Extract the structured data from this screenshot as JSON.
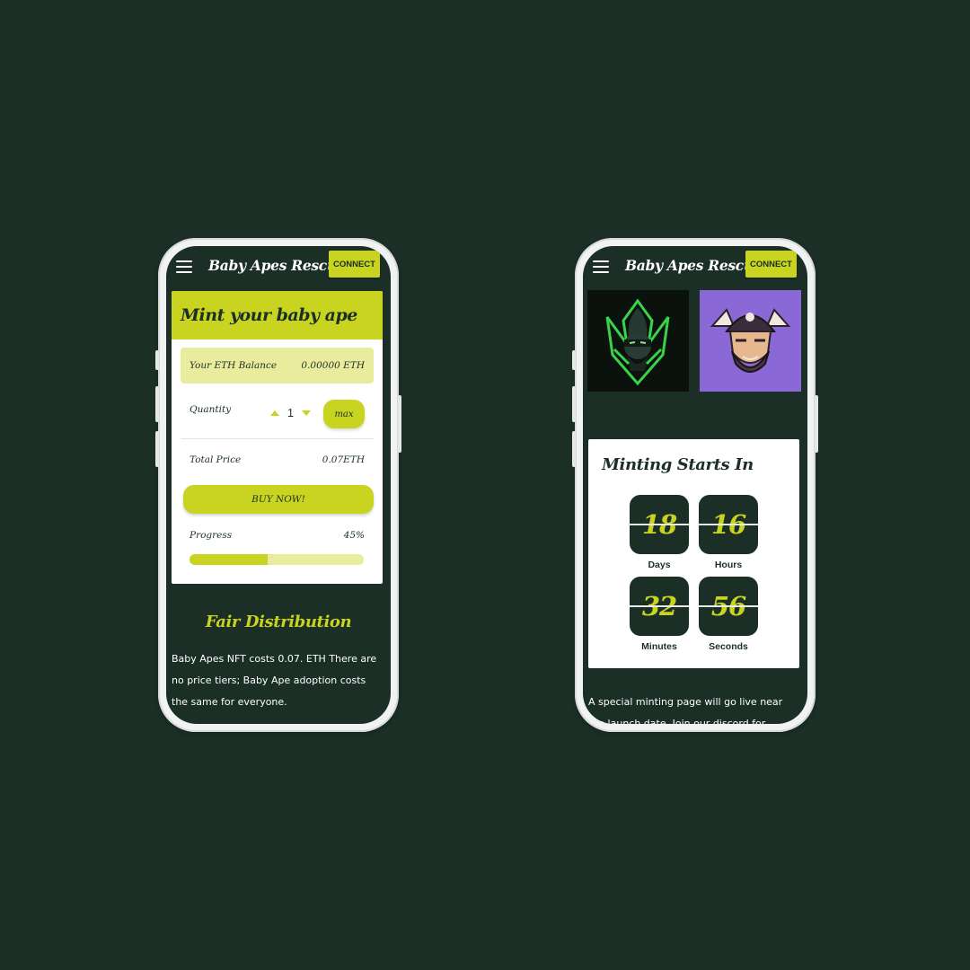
{
  "colors": {
    "background": "#1b2f26",
    "accent": "#c8d41f",
    "accent_light": "#e8ec9c",
    "card": "#ffffff",
    "purple_tile": "#8a68d6"
  },
  "header": {
    "menu_icon": "hamburger-menu-icon",
    "brand": "Baby Apes Rescue",
    "connect_label": "CONNECT"
  },
  "mint": {
    "title": "Mint your baby ape",
    "balance_label": "Your ETH Balance",
    "balance_value": "0.00000 ETH",
    "quantity_label": "Quantity",
    "quantity_value": "1",
    "max_label": "max",
    "total_label": "Total Price",
    "total_value": "0.07ETH",
    "buy_label": "BUY NOW!",
    "progress_label": "Progress",
    "progress_value": "45%",
    "progress_fraction": 0.45
  },
  "fair": {
    "title": "Fair Distribution",
    "text": "Baby Apes NFT costs 0.07. ETH There are no price tiers; Baby Ape adoption costs the same for everyone."
  },
  "gallery": {
    "images": [
      "ninja-mascot-image",
      "pirate-mascot-image"
    ]
  },
  "countdown": {
    "title": "Minting Starts In",
    "units": [
      {
        "value": "18",
        "label": "Days"
      },
      {
        "value": "16",
        "label": "Hours"
      },
      {
        "value": "32",
        "label": "Minutes"
      },
      {
        "value": "56",
        "label": "Seconds"
      }
    ]
  },
  "info": {
    "text": "A special minting page will go live near the launch date. Join our discord for"
  }
}
